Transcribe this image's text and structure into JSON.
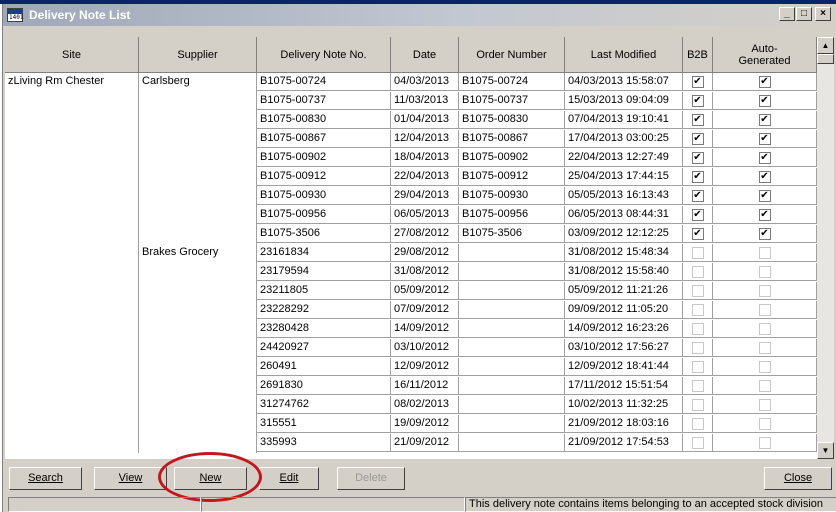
{
  "window": {
    "title": "Delivery Note List",
    "icon_text": "1401"
  },
  "columns": [
    "Site",
    "Supplier",
    "Delivery Note No.",
    "Date",
    "Order Number",
    "Last Modified",
    "B2B",
    "Auto-Generated"
  ],
  "site": "zLiving Rm Chester",
  "suppliers": [
    "Carlsberg",
    "Brakes Grocery"
  ],
  "rows": [
    {
      "note": "B1075-00724",
      "date": "04/03/2013",
      "order": "B1075-00724",
      "modified": "04/03/2013 15:58:07",
      "b2b": true,
      "auto": true
    },
    {
      "note": "B1075-00737",
      "date": "11/03/2013",
      "order": "B1075-00737",
      "modified": "15/03/2013 09:04:09",
      "b2b": true,
      "auto": true
    },
    {
      "note": "B1075-00830",
      "date": "01/04/2013",
      "order": "B1075-00830",
      "modified": "07/04/2013 19:10:41",
      "b2b": true,
      "auto": true
    },
    {
      "note": "B1075-00867",
      "date": "12/04/2013",
      "order": "B1075-00867",
      "modified": "17/04/2013 03:00:25",
      "b2b": true,
      "auto": true
    },
    {
      "note": "B1075-00902",
      "date": "18/04/2013",
      "order": "B1075-00902",
      "modified": "22/04/2013 12:27:49",
      "b2b": true,
      "auto": true
    },
    {
      "note": "B1075-00912",
      "date": "22/04/2013",
      "order": "B1075-00912",
      "modified": "25/04/2013 17:44:15",
      "b2b": true,
      "auto": true
    },
    {
      "note": "B1075-00930",
      "date": "29/04/2013",
      "order": "B1075-00930",
      "modified": "05/05/2013 16:13:43",
      "b2b": true,
      "auto": true
    },
    {
      "note": "B1075-00956",
      "date": "06/05/2013",
      "order": "B1075-00956",
      "modified": "06/05/2013 08:44:31",
      "b2b": true,
      "auto": true
    },
    {
      "note": "B1075-3506",
      "date": "27/08/2012",
      "order": "B1075-3506",
      "modified": "03/09/2012 12:12:25",
      "b2b": true,
      "auto": true
    },
    {
      "note": "23161834",
      "date": "29/08/2012",
      "order": "",
      "modified": "31/08/2012 15:48:34",
      "b2b": false,
      "auto": false
    },
    {
      "note": "23179594",
      "date": "31/08/2012",
      "order": "",
      "modified": "31/08/2012 15:58:40",
      "b2b": false,
      "auto": false
    },
    {
      "note": "23211805",
      "date": "05/09/2012",
      "order": "",
      "modified": "05/09/2012 11:21:26",
      "b2b": false,
      "auto": false
    },
    {
      "note": "23228292",
      "date": "07/09/2012",
      "order": "",
      "modified": "09/09/2012 11:05:20",
      "b2b": false,
      "auto": false
    },
    {
      "note": "23280428",
      "date": "14/09/2012",
      "order": "",
      "modified": "14/09/2012 16:23:26",
      "b2b": false,
      "auto": false
    },
    {
      "note": "24420927",
      "date": "03/10/2012",
      "order": "",
      "modified": "03/10/2012 17:56:27",
      "b2b": false,
      "auto": false
    },
    {
      "note": "260491",
      "date": "12/09/2012",
      "order": "",
      "modified": "12/09/2012 18:41:44",
      "b2b": false,
      "auto": false
    },
    {
      "note": "2691830",
      "date": "16/11/2012",
      "order": "",
      "modified": "17/11/2012 15:51:54",
      "b2b": false,
      "auto": false
    },
    {
      "note": "31274762",
      "date": "08/02/2013",
      "order": "",
      "modified": "10/02/2013 11:32:25",
      "b2b": false,
      "auto": false
    },
    {
      "note": "315551",
      "date": "19/09/2012",
      "order": "",
      "modified": "21/09/2012 18:03:16",
      "b2b": false,
      "auto": false
    },
    {
      "note": "335993",
      "date": "21/09/2012",
      "order": "",
      "modified": "21/09/2012 17:54:53",
      "b2b": false,
      "auto": false
    }
  ],
  "buttons": {
    "search": "Search",
    "view": "View",
    "new": "New",
    "edit": "Edit",
    "delete": "Delete",
    "close": "Close"
  },
  "status": {
    "message": "This delivery note contains items belonging to an accepted stock division"
  },
  "colors": {
    "highlight_ring": "#c4161c",
    "window_face": "#d4d0c8"
  }
}
